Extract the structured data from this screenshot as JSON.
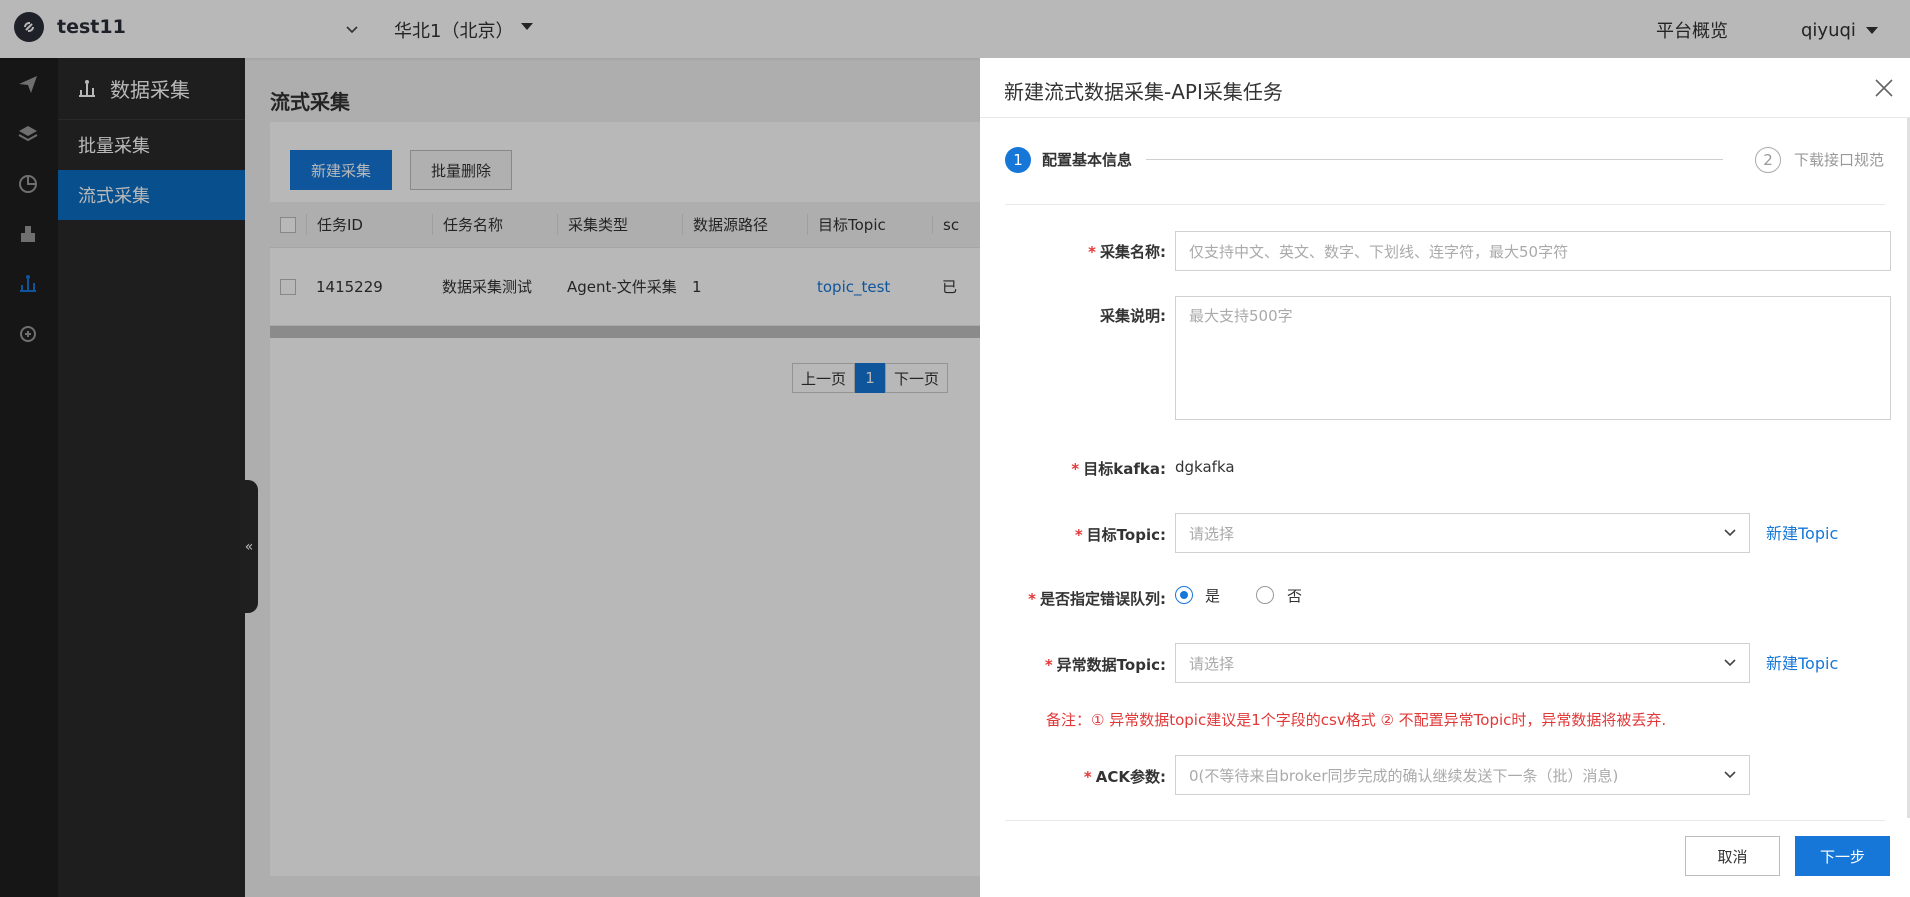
{
  "header": {
    "app_title": "test11",
    "region": "华北1（北京）",
    "platform_overview": "平台概览",
    "user": "qiyuqi"
  },
  "rail": {
    "icons": [
      "send-icon",
      "layers-icon",
      "pie-chart-icon",
      "agent-icon",
      "data-collection-icon",
      "engine-icon"
    ]
  },
  "sidebar": {
    "title": "数据采集",
    "items": [
      {
        "label": "批量采集",
        "active": false
      },
      {
        "label": "流式采集",
        "active": true
      }
    ]
  },
  "main": {
    "page_title": "流式采集",
    "new_button": "新建采集",
    "delete_button": "批量删除",
    "table": {
      "columns": [
        "任务ID",
        "任务名称",
        "采集类型",
        "数据源路径",
        "目标Topic",
        "sc"
      ],
      "rows": [
        {
          "id": "1415229",
          "name": "数据采集测试",
          "type": "Agent-文件采集",
          "path": "1",
          "topic": "topic_test",
          "status": "已"
        }
      ]
    },
    "pager": {
      "prev": "上一页",
      "current": "1",
      "next": "下一页"
    }
  },
  "drawer": {
    "title": "新建流式数据采集-API采集任务",
    "steps": [
      {
        "num": "1",
        "label": "配置基本信息"
      },
      {
        "num": "2",
        "label": "下载接口规范"
      }
    ],
    "fields": {
      "name_label": "采集名称:",
      "name_placeholder": "仅支持中文、英文、数字、下划线、连字符，最大50字符",
      "desc_label": "采集说明:",
      "desc_placeholder": "最大支持500字",
      "kafka_label": "目标kafka:",
      "kafka_value": "dgkafka",
      "topic_label": "目标Topic:",
      "topic_placeholder": "请选择",
      "new_topic": "新建Topic",
      "error_queue_label": "是否指定错误队列:",
      "yes": "是",
      "no": "否",
      "error_topic_label": "异常数据Topic:",
      "error_topic_placeholder": "请选择",
      "note": "备注：① 异常数据topic建议是1个字段的csv格式 ② 不配置异常Topic时，异常数据将被丢弃.",
      "ack_label": "ACK参数:",
      "ack_placeholder": "0(不等待来自broker同步完成的确认继续发送下一条（批）消息)"
    },
    "cancel": "取消",
    "next": "下一步"
  },
  "colors": {
    "primary": "#1677d9",
    "rail": "#1f1f1f",
    "sidebar": "#2a2a2a",
    "required": "#e23838"
  }
}
